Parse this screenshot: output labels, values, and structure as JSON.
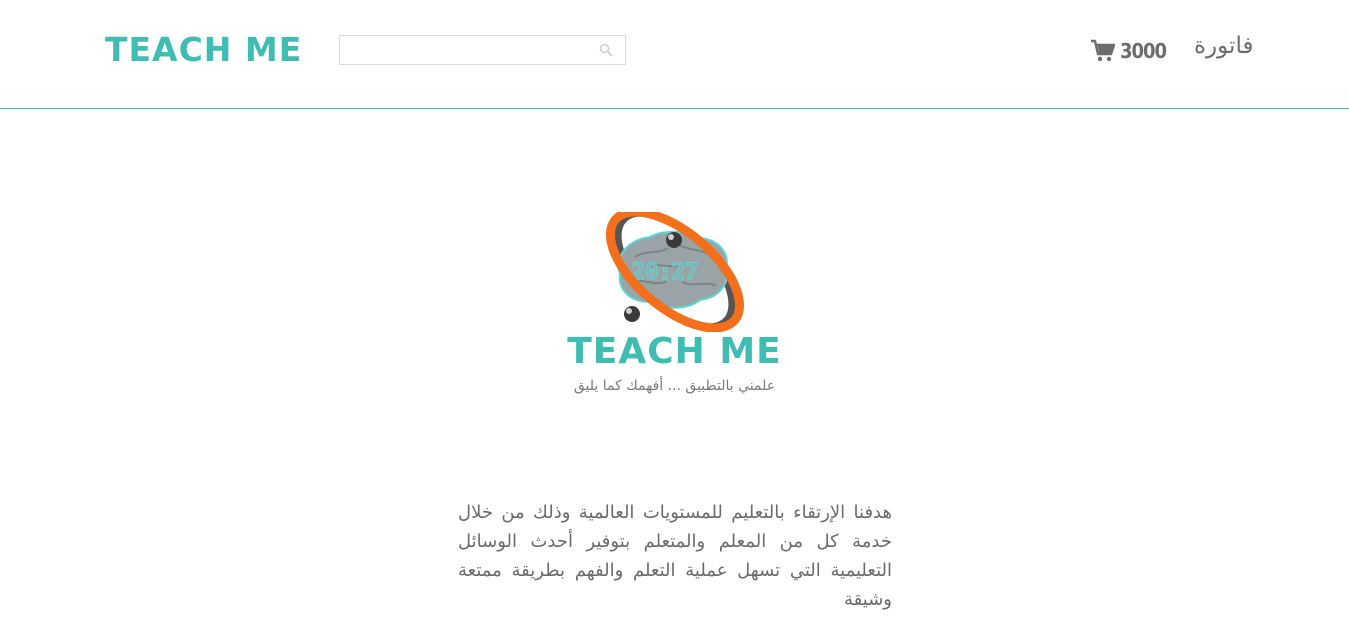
{
  "header": {
    "logo_text": "TEACH ME",
    "search": {
      "value": "",
      "placeholder": ""
    },
    "cart": {
      "count": "3000",
      "icon": "shopping-cart-icon"
    },
    "invoice_label": "فاتورة"
  },
  "hero": {
    "clock_text": "20:27",
    "brand_text": "TEACH ME",
    "tagline": "علمني بالتطبيق ... أفهمك كما يليق"
  },
  "about": {
    "description": "هدفنا الإرتقاء بالتعليم للمستويات العالمية وذلك من خلال خدمة كل من المعلم والمتعلم بتوفير أحدث الوسائل التعليمية التي تسهل عملية التعلم والفهم بطريقة ممتعة وشيقة"
  },
  "colors": {
    "accent": "#3fbdb3",
    "text": "#6b6b6b",
    "orange": "#f36f1b",
    "divider": "#4fb8b9"
  }
}
